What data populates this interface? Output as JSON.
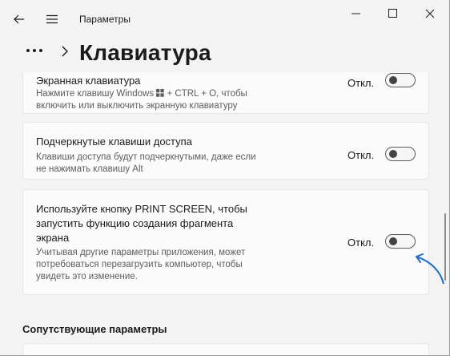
{
  "window": {
    "app_title": "Параметры",
    "minimize_icon": "minimize-icon",
    "maximize_icon": "maximize-icon",
    "close_icon": "close-icon"
  },
  "nav": {
    "back_icon": "back-arrow-icon",
    "menu_icon": "hamburger-menu-icon"
  },
  "header": {
    "more_icon": "more-dots-icon",
    "chevron_icon": "chevron-right-icon",
    "page_title": "Клавиатура"
  },
  "settings": [
    {
      "title": "Экранная клавиатура",
      "description_line1": "Нажмите клавишу Windows",
      "description_line1_rest": "+ CTRL + O, чтобы",
      "description_line2": "включить или выключить экранную клавиатуру",
      "state": "Откл.",
      "enabled": false
    },
    {
      "title": "Подчеркнутые клавиши доступа",
      "description_line1": "Клавиши доступа будут подчеркнутыми, даже если",
      "description_line2": "не нажимать клавишу Alt",
      "state": "Откл.",
      "enabled": false
    },
    {
      "title_line1": "Используйте кнопку PRINT SCREEN, чтобы",
      "title_line2": "запустить функцию создания фрагмента",
      "title_line3": "экрана",
      "description_line1": "Учитывая другие параметры приложения, может",
      "description_line2": "потребоваться перезагрузить компьютер, чтобы",
      "description_line3": "увидеть это изменение.",
      "state": "Откл.",
      "enabled": false
    }
  ],
  "related": {
    "heading": "Сопутствующие параметры"
  },
  "colors": {
    "background": "#f3f3f3",
    "card": "#fbfbfb",
    "annotation_arrow": "#1e6fc8"
  }
}
